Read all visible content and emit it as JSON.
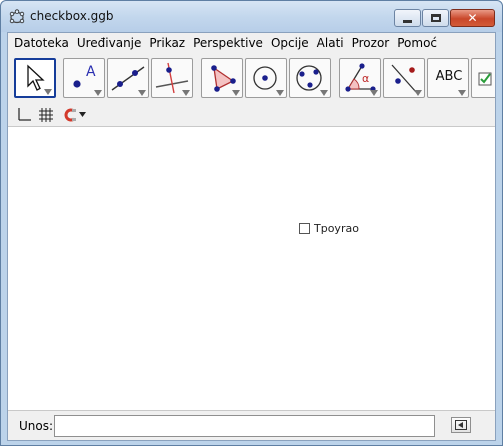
{
  "window": {
    "title": "checkbox.ggb",
    "title_color": "#111111",
    "frame_color": "#bcd3ea",
    "close_color": "#c9472a"
  },
  "menu": {
    "items": [
      "Datoteka",
      "Uređivanje",
      "Prikaz",
      "Perspektive",
      "Opcije",
      "Alati",
      "Prozor",
      "Pomoć"
    ]
  },
  "toolbar": {
    "tools": [
      {
        "icon": "move-arrow-icon",
        "selected": true
      },
      {
        "icon": "point-icon",
        "label": "A"
      },
      {
        "icon": "line-through-two-points-icon"
      },
      {
        "icon": "perpendicular-line-icon"
      },
      {
        "icon": "polygon-icon"
      },
      {
        "icon": "circle-center-point-icon"
      },
      {
        "icon": "circle-three-points-icon"
      },
      {
        "icon": "angle-icon",
        "label": "α"
      },
      {
        "icon": "reflect-about-line-icon"
      },
      {
        "icon": "text-icon",
        "label": "ABC"
      },
      {
        "icon": "checkbox-tool-icon"
      }
    ],
    "selected_border_color": "#163d9a"
  },
  "stylebar": {
    "icons": [
      "axes-icon",
      "grid-icon",
      "point-capturing-icon",
      "dropdown-arrow-icon"
    ]
  },
  "graphics": {
    "checkbox": {
      "label": "Tpoyrao",
      "checked": false
    }
  },
  "inputbar": {
    "label": "Unos:",
    "value": "",
    "help_icon": "input-help-icon"
  }
}
